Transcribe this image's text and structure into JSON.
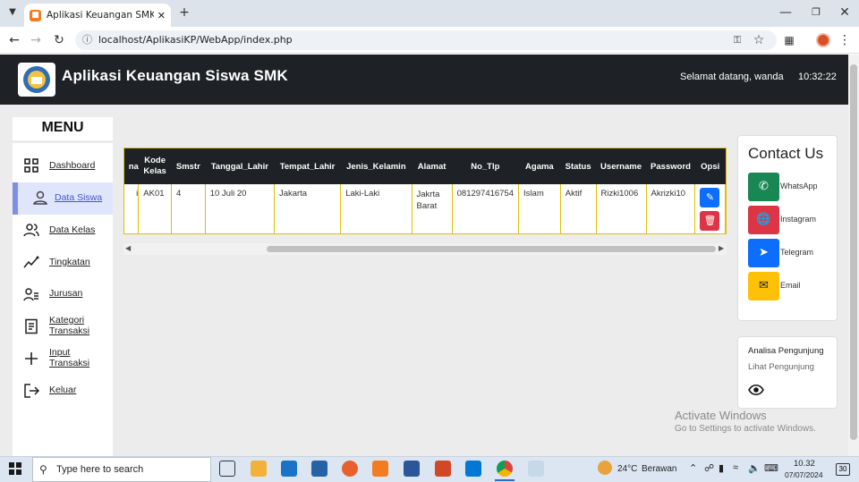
{
  "browser": {
    "tab_title": "Aplikasi Keuangan SMK Padindi",
    "url": "localhost/AplikasiKP/WebApp/index.php"
  },
  "header": {
    "title": "Aplikasi Keuangan Siswa SMK",
    "welcome": "Selamat datang, wanda",
    "time": "10:32:22"
  },
  "sidebar": {
    "menu_title": "MENU",
    "items": [
      {
        "label": "Dashboard",
        "icon": "dashboard-icon",
        "active": false
      },
      {
        "label": "Data Siswa",
        "icon": "user-icon",
        "active": true
      },
      {
        "label": "Data Kelas",
        "icon": "users-icon",
        "active": false
      },
      {
        "label": "Tingkatan",
        "icon": "chart-line-icon",
        "active": false
      },
      {
        "label": "Jurusan",
        "icon": "list-user-icon",
        "active": false
      },
      {
        "label": "Kategori Transaksi",
        "icon": "document-icon",
        "active": false
      },
      {
        "label": "Input Transaksi",
        "icon": "plus-icon",
        "active": false
      },
      {
        "label": "Keluar",
        "icon": "logout-icon",
        "active": false
      }
    ]
  },
  "table": {
    "headers": [
      "na",
      "Kode Kelas",
      "Smstr",
      "Tanggal_Lahir",
      "Tempat_Lahir",
      "Jenis_Kelamin",
      "Alamat",
      "No_Tlp",
      "Agama",
      "Status",
      "Username",
      "Password",
      "Opsi"
    ],
    "rows": [
      [
        "i",
        "AK01",
        "4",
        "10 Juli 20",
        "Jakarta",
        "Laki-Laki",
        "Jakrta Barat",
        "081297416754",
        "Islam",
        "Aktif",
        "Rizki1006",
        "Akrizki10",
        ""
      ]
    ]
  },
  "contact": {
    "title": "Contact Us",
    "items": [
      {
        "label": "WhatsApp",
        "icon": "phone-icon",
        "color": "#198754"
      },
      {
        "label": "Instagram",
        "icon": "globe-icon",
        "color": "#dc3545"
      },
      {
        "label": "Telegram",
        "icon": "send-icon",
        "color": "#0d6efd"
      },
      {
        "label": "Email",
        "icon": "mail-icon",
        "color": "#ffc107"
      }
    ]
  },
  "analisa": {
    "title": "Analisa Pengunjung",
    "subtitle": "Lihat Pengunjung"
  },
  "watermark": {
    "line1": "Activate Windows",
    "line2": "Go to Settings to activate Windows."
  },
  "taskbar": {
    "search_placeholder": "Type here to search",
    "weather_temp": "24°C",
    "weather_desc": "Berawan",
    "time": "10.32",
    "date": "07/07/2024",
    "notifications": "30"
  }
}
